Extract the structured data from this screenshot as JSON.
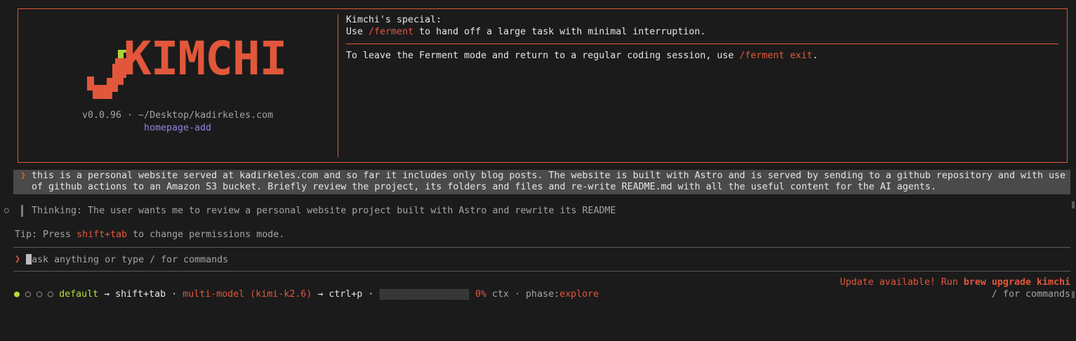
{
  "header": {
    "logo_text": "KIMCHI",
    "version_path": "v0.0.96 · ~/Desktop/kadirkeles.com",
    "branch": "homepage-add",
    "special_title": "Kimchi's special:",
    "special_pre": "Use ",
    "special_cmd": "/ferment",
    "special_post": " to hand off a large task with minimal interruption.",
    "leave_pre": "To leave the Ferment mode and return to a regular coding session, use ",
    "leave_cmd": "/ferment exit",
    "leave_post": "."
  },
  "user_message": {
    "prompt_glyph": "❯",
    "line1": "this is a personal website served at kadirkeles.com and so far it includes only blog posts. The website is built with Astro and is served by sending to a github repository and with use",
    "line2": "of github actions to an Amazon S3 bucket. Briefly review the project, its folders and files and re-write README.md with all the useful content for the AI agents."
  },
  "thinking": {
    "glyph": "○",
    "text": "Thinking: The user wants me to review a personal website project built with Astro and rewrite its README"
  },
  "tip": {
    "pre": "Tip: Press ",
    "key": "shift+tab",
    "post": " to change permissions mode."
  },
  "input": {
    "prompt_glyph": "❯",
    "placeholder": "ask anything or type / for commands"
  },
  "status": {
    "dot_active": "●",
    "dots_inactive": "○ ○ ○",
    "mode": "default",
    "mode_hint": " → shift+tab · ",
    "model": "multi-model (kimi-k2.6)",
    "model_hint": " → ctrl+p · ",
    "ctx_percent": "0%",
    "ctx_value": 0,
    "ctx_label": " ctx · phase:",
    "phase": "explore",
    "update_pre": "Update available! Run ",
    "update_cmd": "brew upgrade kimchi",
    "commands_hint": "/ for commands"
  },
  "colors": {
    "accent": "#e2573b",
    "green": "#b5dd3a",
    "purple": "#8d85e6",
    "background": "#1b1b1b"
  }
}
